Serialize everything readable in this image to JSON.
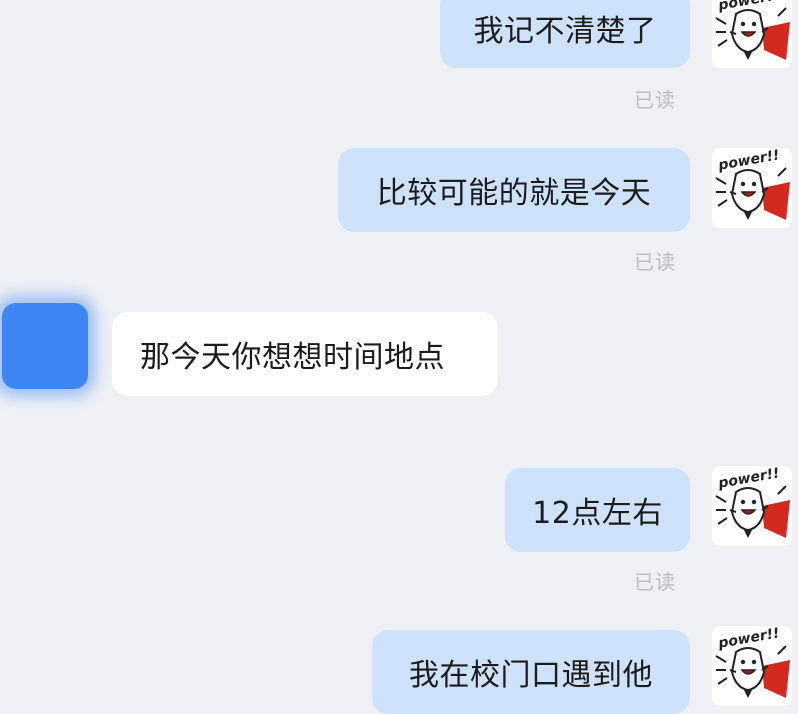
{
  "messages": [
    {
      "sender": "self",
      "text": "我记不清楚了",
      "status": "已读"
    },
    {
      "sender": "self",
      "text": "比较可能的就是今天",
      "status": "已读"
    },
    {
      "sender": "other",
      "text": "那今天你想想时间地点"
    },
    {
      "sender": "self",
      "text": "12点左右",
      "status": "已读"
    },
    {
      "sender": "self",
      "text": "我在校门口遇到他"
    }
  ],
  "self_avatar": {
    "icon": "cartoon-character-power-sticker-icon",
    "caption": "power!!"
  },
  "other_avatar": {
    "icon": "blurred-avatar",
    "color": "#3f86f5"
  },
  "colors": {
    "background": "#eef0f4",
    "self_bubble": "#cfe2fb",
    "other_bubble": "#ffffff",
    "read_status": "#b9bcc3"
  }
}
